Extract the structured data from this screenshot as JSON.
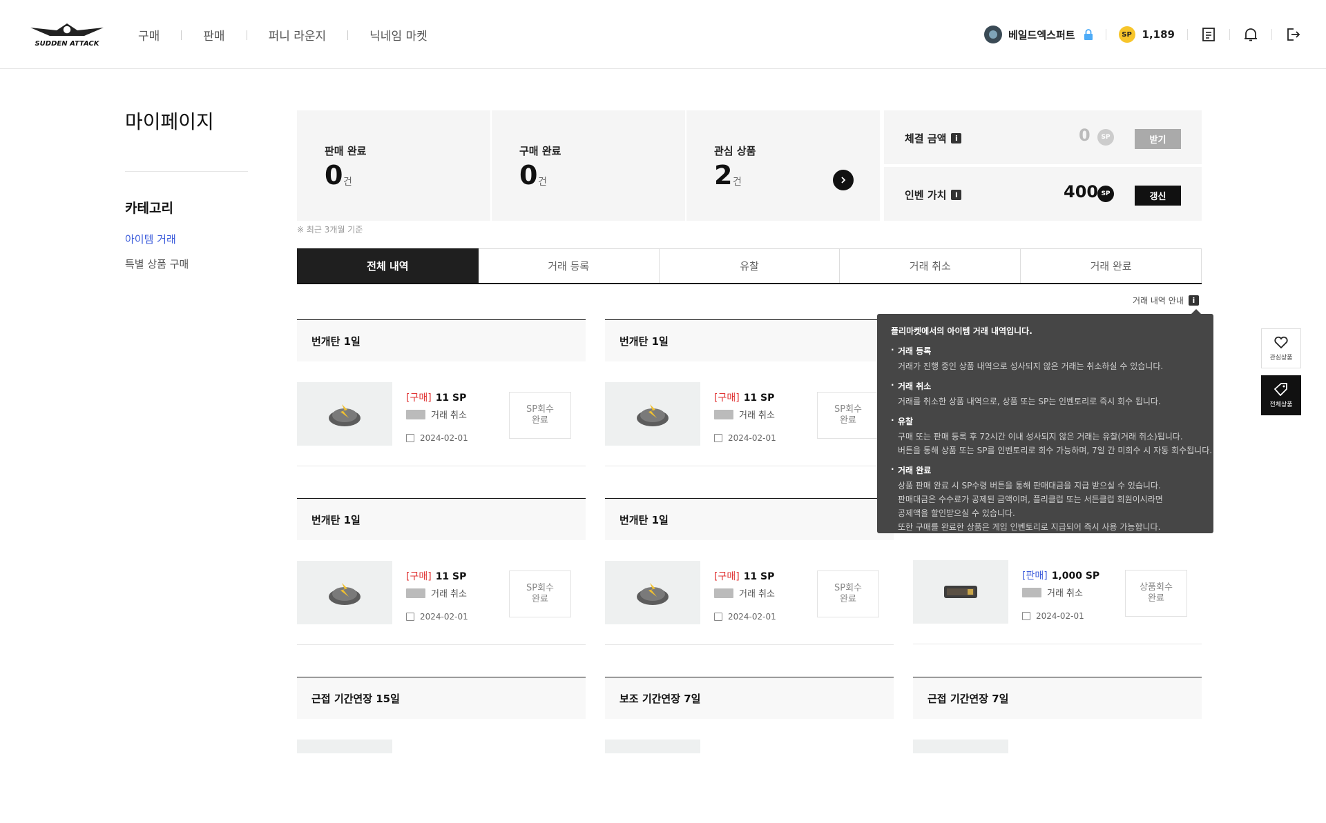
{
  "header": {
    "logo_text": "SUDDEN ATTACK",
    "nav": [
      "구매",
      "판매",
      "퍼니 라운지",
      "닉네임 마켓"
    ],
    "nickname": "베일드엑스퍼트",
    "sp_label": "SP",
    "sp_amount": "1,189"
  },
  "side": {
    "page_title": "마이페이지",
    "category_title": "카테고리",
    "items": [
      "아이템 거래",
      "특별 상품 구매"
    ]
  },
  "summary": {
    "sales_label": "판매 완료",
    "sales_count": "0",
    "purchase_label": "구매 완료",
    "purchase_count": "0",
    "wish_label": "관심 상품",
    "wish_count": "2",
    "unit": "건",
    "settle_label": "체결 금액",
    "settle_value": "0",
    "settle_button": "받기",
    "inven_label": "인벤 가치",
    "inven_value": "400",
    "inven_button": "갱신",
    "sp_badge": "SP",
    "info_icon": "i",
    "note": "※ 최근 3개월 기준"
  },
  "tabs": [
    "전체 내역",
    "거래 등록",
    "유찰",
    "거래 취소",
    "거래 완료"
  ],
  "guide_label": "거래 내역 안내",
  "cards": [
    {
      "title": "번개탄 1일",
      "tag": "[구매]",
      "price": "11 SP",
      "status": "거래 취소",
      "date": "2024-02-01",
      "button": "SP회수\n완료"
    },
    {
      "title": "번개탄 1일",
      "tag": "[구매]",
      "price": "11 SP",
      "status": "거래 취소",
      "date": "2024-02-01",
      "button": "SP회수\n완료"
    },
    {
      "title": "번개탄 1일",
      "tag": "[구매]",
      "price": "11 SP",
      "status": "거래 취소",
      "date": "2024-02-01",
      "button": "SP회수\n완료"
    },
    {
      "title": "번개탄 1일",
      "tag": "[구매]",
      "price": "11 SP",
      "status": "거래 취소",
      "date": "2024-02-01",
      "button": "SP회수\n완료"
    },
    {
      "title": "",
      "tag": "[판매]",
      "price": "1,000 SP",
      "status": "거래 취소",
      "date": "2024-02-01",
      "button": "상품회수\n완료"
    },
    {
      "title": "근접 기간연장 15일"
    },
    {
      "title": "보조 기간연장 7일"
    },
    {
      "title": "근접 기간연장 7일"
    }
  ],
  "tooltip": {
    "title": "플리마켓에서의 아이템 거래 내역입니다.",
    "sections": [
      {
        "h": "거래 등록",
        "p": [
          "거래가 진행 중인 상품 내역으로 성사되지 않은 거래는 취소하실 수 있습니다."
        ]
      },
      {
        "h": "거래 취소",
        "p": [
          "거래를 취소한 상품 내역으로, 상품 또는 SP는 인벤토리로 즉시 회수 됩니다."
        ]
      },
      {
        "h": "유찰",
        "p": [
          "구매 또는 판매 등록 후 72시간 이내 성사되지 않은 거래는 유찰(거래 취소)됩니다.",
          "버튼을 통해 상품 또는 SP를 인벤토리로 회수 가능하며, 7일 간 미회수 시 자동 회수됩니다."
        ]
      },
      {
        "h": "거래 완료",
        "p": [
          "상품 판매 완료 시 SP수령 버튼을 통해 판매대금을 지급 받으실 수 있습니다.",
          "판매대금은 수수료가 공제된 금액이며, 플리클럽 또는 서든클럽 회원이시라면",
          "공제액을 할인받으실 수 있습니다.",
          "또한 구매를 완료한 상품은 게임 인벤토리로 지급되어 즉시 사용 가능합니다."
        ]
      }
    ]
  },
  "floating": {
    "wish_label": "관심상품",
    "all_label": "전체상품"
  },
  "colors": {
    "accent_blue": "#3b5bdb",
    "buy_red": "#e03131",
    "coin_yellow": "#f7c52a"
  }
}
